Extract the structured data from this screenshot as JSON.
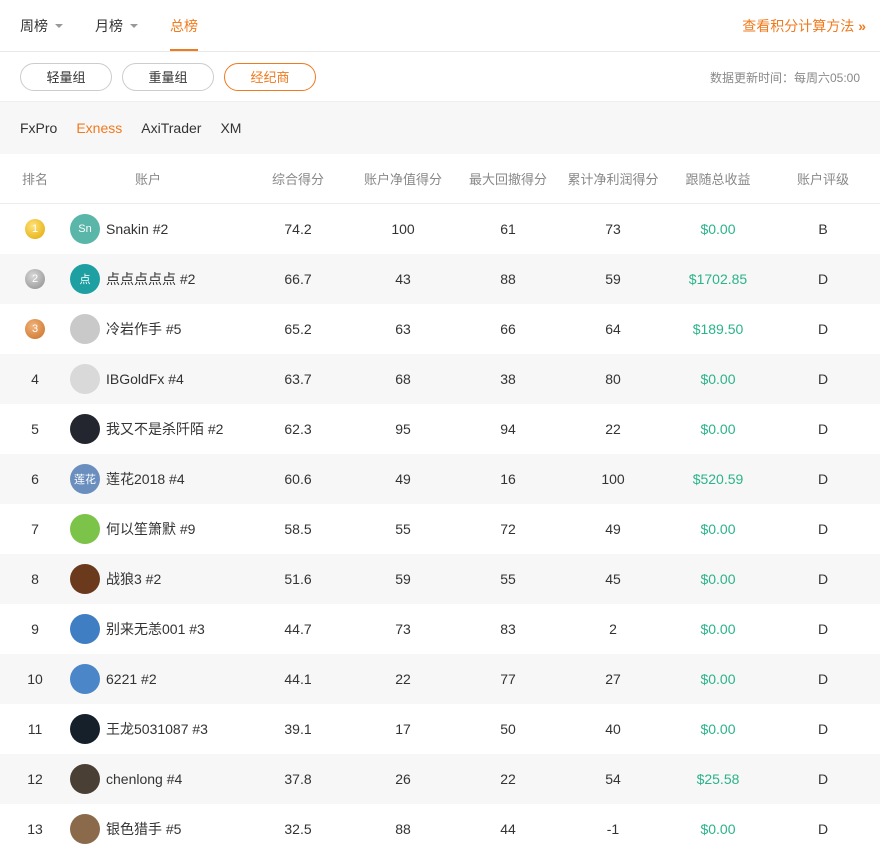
{
  "top_tabs": [
    {
      "label": "周榜",
      "has_caret": true,
      "active": false
    },
    {
      "label": "月榜",
      "has_caret": true,
      "active": false
    },
    {
      "label": "总榜",
      "has_caret": false,
      "active": true
    }
  ],
  "calc_link": {
    "label": "查看积分计算方法",
    "icon": "double-chevron-right-icon",
    "chevron": "»"
  },
  "groups": [
    {
      "label": "轻量组",
      "active": false
    },
    {
      "label": "重量组",
      "active": false
    },
    {
      "label": "经纪商",
      "active": true
    }
  ],
  "update_time": "数据更新时间：每周六05:00",
  "brokers": [
    {
      "label": "FxPro",
      "active": false
    },
    {
      "label": "Exness",
      "active": true
    },
    {
      "label": "AxiTrader",
      "active": false
    },
    {
      "label": "XM",
      "active": false
    }
  ],
  "colors": {
    "accent": "#f07a1e",
    "money": "#2bb38a"
  },
  "table": {
    "headers": [
      "排名",
      "账户",
      "综合得分",
      "账户净值得分",
      "最大回撤得分",
      "累计净利润得分",
      "跟随总收益",
      "账户评级"
    ],
    "rows": [
      {
        "rank": "1",
        "medal": "gold",
        "avatar_text": "Sn",
        "avatar_color": "#5ab6a8",
        "account": "Snakin #2",
        "score": "74.2",
        "equity": "100",
        "drawdown": "61",
        "profit": "73",
        "follow": "$0.00",
        "grade": "B"
      },
      {
        "rank": "2",
        "medal": "silver",
        "avatar_text": "点",
        "avatar_color": "#1ea0a3",
        "account": "点点点点点 #2",
        "score": "66.7",
        "equity": "43",
        "drawdown": "88",
        "profit": "59",
        "follow": "$1702.85",
        "grade": "D"
      },
      {
        "rank": "3",
        "medal": "bronze",
        "avatar_text": "",
        "avatar_color": "#c9c9c9",
        "account": "冷岩作手 #5",
        "score": "65.2",
        "equity": "63",
        "drawdown": "66",
        "profit": "64",
        "follow": "$189.50",
        "grade": "D"
      },
      {
        "rank": "4",
        "medal": "",
        "avatar_text": "",
        "avatar_color": "#d9d9d9",
        "account": "IBGoldFx #4",
        "score": "63.7",
        "equity": "68",
        "drawdown": "38",
        "profit": "80",
        "follow": "$0.00",
        "grade": "D"
      },
      {
        "rank": "5",
        "medal": "",
        "avatar_text": "",
        "avatar_color": "#23262e",
        "account": "我又不是杀阡陌 #2",
        "score": "62.3",
        "equity": "95",
        "drawdown": "94",
        "profit": "22",
        "follow": "$0.00",
        "grade": "D"
      },
      {
        "rank": "6",
        "medal": "",
        "avatar_text": "莲花",
        "avatar_color": "#6a8fbf",
        "account": "莲花2018 #4",
        "score": "60.6",
        "equity": "49",
        "drawdown": "16",
        "profit": "100",
        "follow": "$520.59",
        "grade": "D"
      },
      {
        "rank": "7",
        "medal": "",
        "avatar_text": "",
        "avatar_color": "#7cc34a",
        "account": "何以笙箫默 #9",
        "score": "58.5",
        "equity": "55",
        "drawdown": "72",
        "profit": "49",
        "follow": "$0.00",
        "grade": "D"
      },
      {
        "rank": "8",
        "medal": "",
        "avatar_text": "",
        "avatar_color": "#6b3a1c",
        "account": "战狼3 #2",
        "score": "51.6",
        "equity": "59",
        "drawdown": "55",
        "profit": "45",
        "follow": "$0.00",
        "grade": "D"
      },
      {
        "rank": "9",
        "medal": "",
        "avatar_text": "",
        "avatar_color": "#3f7ec2",
        "account": "别来无恙001 #3",
        "score": "44.7",
        "equity": "73",
        "drawdown": "83",
        "profit": "2",
        "follow": "$0.00",
        "grade": "D"
      },
      {
        "rank": "10",
        "medal": "",
        "avatar_text": "",
        "avatar_color": "#4a86c8",
        "account": "6221 #2",
        "score": "44.1",
        "equity": "22",
        "drawdown": "77",
        "profit": "27",
        "follow": "$0.00",
        "grade": "D"
      },
      {
        "rank": "11",
        "medal": "",
        "avatar_text": "",
        "avatar_color": "#15202b",
        "account": "王龙5031087 #3",
        "score": "39.1",
        "equity": "17",
        "drawdown": "50",
        "profit": "40",
        "follow": "$0.00",
        "grade": "D"
      },
      {
        "rank": "12",
        "medal": "",
        "avatar_text": "",
        "avatar_color": "#4a3f35",
        "account": "chenlong #4",
        "score": "37.8",
        "equity": "26",
        "drawdown": "22",
        "profit": "54",
        "follow": "$25.58",
        "grade": "D"
      },
      {
        "rank": "13",
        "medal": "",
        "avatar_text": "",
        "avatar_color": "#8a6a4a",
        "account": "银色猎手 #5",
        "score": "32.5",
        "equity": "88",
        "drawdown": "44",
        "profit": "-1",
        "follow": "$0.00",
        "grade": "D"
      }
    ]
  }
}
